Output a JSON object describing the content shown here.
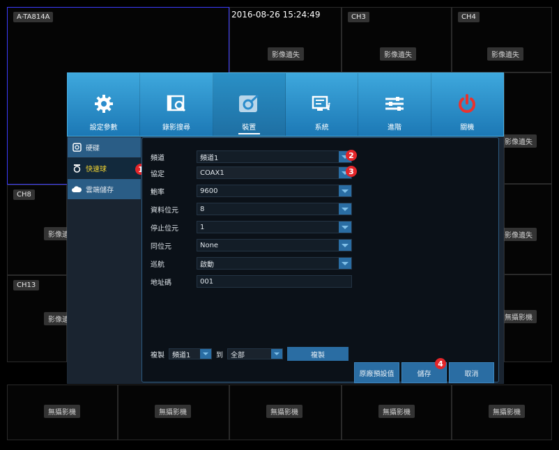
{
  "grid": {
    "timestamp": "2016-08-26 15:24:49",
    "tiles_top": [
      {
        "tag": "A-TA814A",
        "status": ""
      },
      {
        "tag": "",
        "status": "影像遺失"
      },
      {
        "tag": "CH3",
        "status": "影像遺失"
      },
      {
        "tag": "CH4",
        "status": "影像遺失"
      }
    ],
    "right_side_status": [
      "影像遺失",
      "影像遺失",
      "無攝影機"
    ],
    "left_side": [
      {
        "tag": "CH8",
        "status": "影像遺"
      },
      {
        "tag": "CH13",
        "status": "影像遺"
      }
    ],
    "bottom_row": [
      "無攝影機",
      "無攝影機",
      "無攝影機",
      "無攝影機",
      "無攝影機"
    ]
  },
  "menu": {
    "tabs": [
      {
        "label": "設定參數",
        "icon": "gear-icon"
      },
      {
        "label": "錄影搜尋",
        "icon": "film-search-icon"
      },
      {
        "label": "裝置",
        "icon": "device-icon"
      },
      {
        "label": "系統",
        "icon": "system-info-icon"
      },
      {
        "label": "進階",
        "icon": "sliders-icon"
      },
      {
        "label": "關機",
        "icon": "power-icon"
      }
    ],
    "sidebar": [
      {
        "label": "硬碟",
        "icon": "hdd-icon"
      },
      {
        "label": "快速球",
        "icon": "ptz-icon"
      },
      {
        "label": "雲端儲存",
        "icon": "cloud-icon"
      }
    ],
    "fields": [
      {
        "label": "頻道",
        "value": "頻道1"
      },
      {
        "label": "協定",
        "value": "COAX1"
      },
      {
        "label": "鮑率",
        "value": "9600"
      },
      {
        "label": "資料位元",
        "value": "8"
      },
      {
        "label": "停止位元",
        "value": "1"
      },
      {
        "label": "同位元",
        "value": "None"
      },
      {
        "label": "巡航",
        "value": "啟動"
      },
      {
        "label": "地址碼",
        "value": "001"
      }
    ],
    "copy": {
      "label": "複製",
      "from_value": "頻道1",
      "to_label": "到",
      "to_value": "全部",
      "button": "複製"
    },
    "buttons": {
      "default": "原廠預設值",
      "save": "儲存",
      "cancel": "取消"
    },
    "callouts": [
      "1",
      "2",
      "3",
      "4"
    ]
  }
}
